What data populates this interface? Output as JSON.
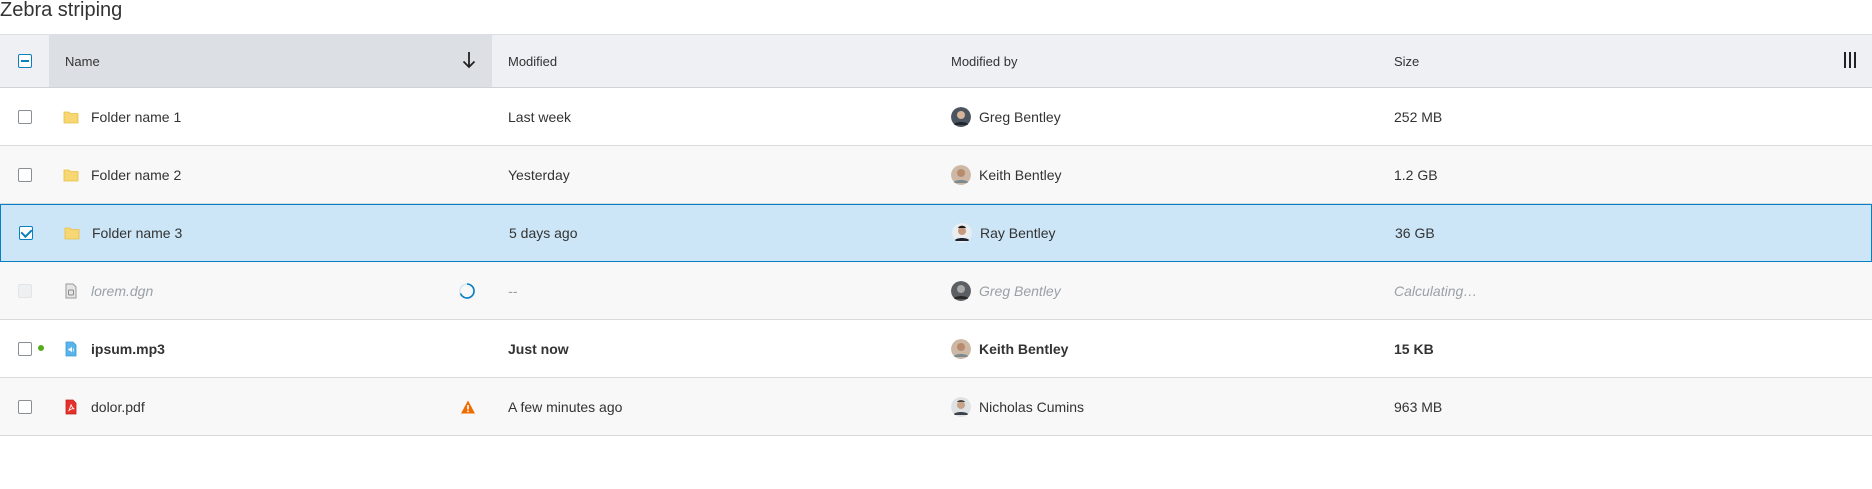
{
  "title": "Zebra striping",
  "header": {
    "name": "Name",
    "modified": "Modified",
    "modified_by": "Modified by",
    "size": "Size"
  },
  "rows": [
    {
      "name": "Folder name 1",
      "modified": "Last week",
      "modified_by": "Greg Bentley",
      "size": "252 MB",
      "icon": "folder-icon",
      "avatar_color": "#4a5560"
    },
    {
      "name": "Folder name 2",
      "modified": "Yesterday",
      "modified_by": "Keith Bentley",
      "size": "1.2 GB",
      "icon": "folder-icon",
      "avatar_color": "#b98b6e"
    },
    {
      "name": "Folder name 3",
      "modified": "5 days ago",
      "modified_by": "Ray Bentley",
      "size": "36 GB",
      "icon": "folder-icon",
      "avatar_color": "#2b3440"
    },
    {
      "name": "lorem.dgn",
      "modified": "--",
      "modified_by": "Greg Bentley",
      "size": "Calculating…",
      "icon": "dgn-file-icon",
      "avatar_color": "#5b5f63"
    },
    {
      "name": "ipsum.mp3",
      "modified": "Just now",
      "modified_by": "Keith Bentley",
      "size": "15 KB",
      "icon": "audio-file-icon",
      "avatar_color": "#b98b6e"
    },
    {
      "name": "dolor.pdf",
      "modified": "A few minutes ago",
      "modified_by": "Nicholas Cumins",
      "size": "963 MB",
      "icon": "pdf-file-icon",
      "avatar_color": "#6b6f73"
    }
  ],
  "colors": {
    "selected_bg": "#cce6f7",
    "selected_border": "#0a7fc2",
    "warning": "#f06c00",
    "new_dot": "#56aa1c",
    "folder": "#f7d774"
  }
}
